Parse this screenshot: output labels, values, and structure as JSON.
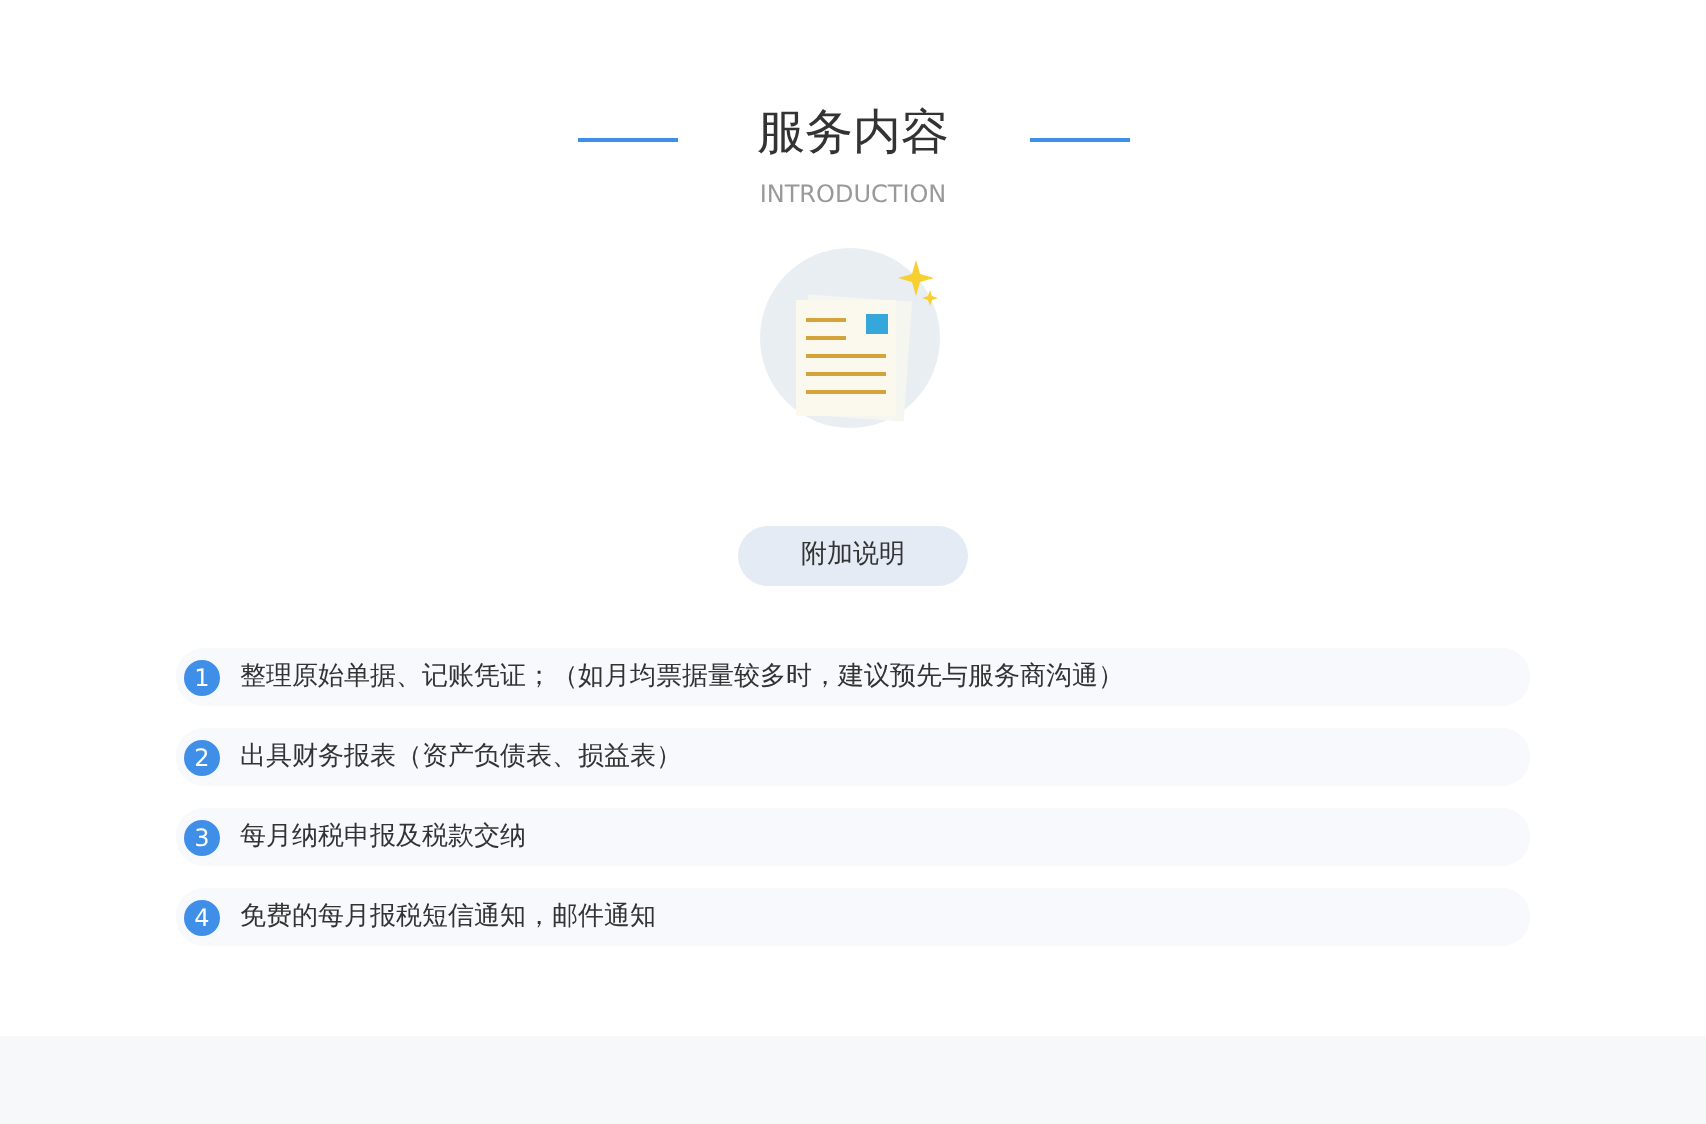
{
  "heading": {
    "title": "服务内容",
    "subtitle": "INTRODUCTION"
  },
  "note_button": "附加说明",
  "items": [
    {
      "number": "1",
      "text": "整理原始单据、记账凭证；（如月均票据量较多时，建议预先与服务商沟通）"
    },
    {
      "number": "2",
      "text": "出具财务报表（资产负债表、损益表）"
    },
    {
      "number": "3",
      "text": "每月纳税申报及税款交纳"
    },
    {
      "number": "4",
      "text": "免费的每月报税短信通知，邮件通知"
    }
  ]
}
